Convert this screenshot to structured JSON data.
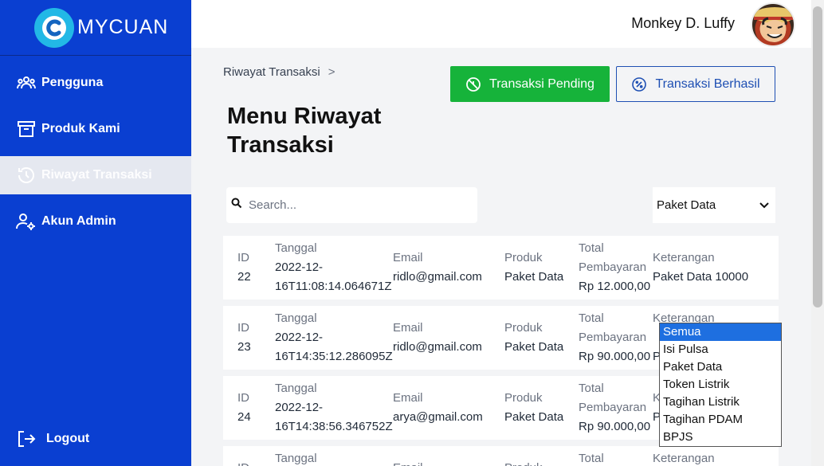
{
  "brand": {
    "name": "MYCUAN"
  },
  "sidebar": {
    "items": [
      {
        "label": "Pengguna",
        "icon": "users-icon"
      },
      {
        "label": "Produk Kami",
        "icon": "archive-box-icon"
      },
      {
        "label": "Riwayat Transaksi",
        "icon": "history-icon",
        "active": true
      },
      {
        "label": "Akun Admin",
        "icon": "user-gear-icon"
      }
    ],
    "logout": "Logout"
  },
  "header": {
    "user_name": "Monkey D. Luffy"
  },
  "breadcrumb": {
    "current": "Riwayat Transaksi",
    "separator": ">"
  },
  "buttons": {
    "pending": "Transaksi Pending",
    "success": "Transaksi Berhasil"
  },
  "title": "Menu Riwayat Transaksi",
  "search": {
    "placeholder": "Search...",
    "value": ""
  },
  "filter": {
    "selected": "Paket Data",
    "options": [
      "Semua",
      "Isi Pulsa",
      "Paket Data",
      "Token Listrik",
      "Tagihan Listrik",
      "Tagihan PDAM",
      "BPJS"
    ],
    "highlighted": "Semua"
  },
  "columns": {
    "id": "ID",
    "date": "Tanggal",
    "email": "Email",
    "product": "Produk",
    "total_line1": "Total",
    "total_line2": "Pembayaran",
    "note": "Keterangan"
  },
  "rows": [
    {
      "id": "22",
      "date1": "2022-12-",
      "date2": "16T11:08:14.064671Z",
      "email": "ridlo@gmail.com",
      "product": "Paket Data",
      "total": "Rp 12.000,00",
      "note": "Paket Data 10000"
    },
    {
      "id": "23",
      "date1": "2022-12-",
      "date2": "16T14:35:12.286095Z",
      "email": "ridlo@gmail.com",
      "product": "Paket Data",
      "total": "Rp 90.000,00",
      "note": "P"
    },
    {
      "id": "24",
      "date1": "2022-12-",
      "date2": "16T14:38:56.346752Z",
      "email": "arya@gmail.com",
      "product": "Paket Data",
      "total": "Rp 90.000,00",
      "note": "P"
    },
    {
      "id": "",
      "date1": "",
      "date2": "",
      "email": "",
      "product": "",
      "total": "",
      "note": ""
    }
  ],
  "colors": {
    "sidebar": "#0a3fd1",
    "pending": "#16b33a",
    "success": "#1e4fb3",
    "logo": "#22b8e6"
  }
}
